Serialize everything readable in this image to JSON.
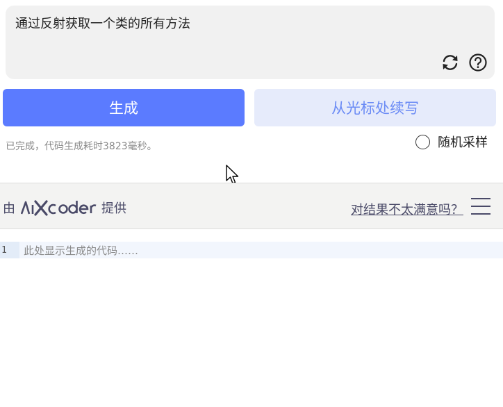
{
  "prompt": {
    "text": "通过反射获取一个类的所有方法",
    "icons": {
      "refresh": "refresh-icon",
      "help": "help-circle-icon"
    }
  },
  "actions": {
    "generate_label": "生成",
    "continue_label": "从光标处续写"
  },
  "status": {
    "message": "已完成，代码生成耗时3823毫秒。"
  },
  "options": {
    "random_sample_label": "随机采样",
    "random_sample_checked": false
  },
  "provider_bar": {
    "prefix": "由",
    "logo_text": "aiXcoder",
    "suffix": "提供",
    "feedback_link": "对结果不太满意吗？",
    "menu_icon": "hamburger-menu-icon"
  },
  "editor": {
    "lines": [
      {
        "number": "1",
        "placeholder": "此处显示生成的代码……"
      }
    ]
  },
  "colors": {
    "primary": "#5b7bff",
    "secondary_bg": "#e6ebfb",
    "secondary_text": "#6b8bf5",
    "brand": "#4a4a68",
    "status_text": "#8a8a8a"
  }
}
